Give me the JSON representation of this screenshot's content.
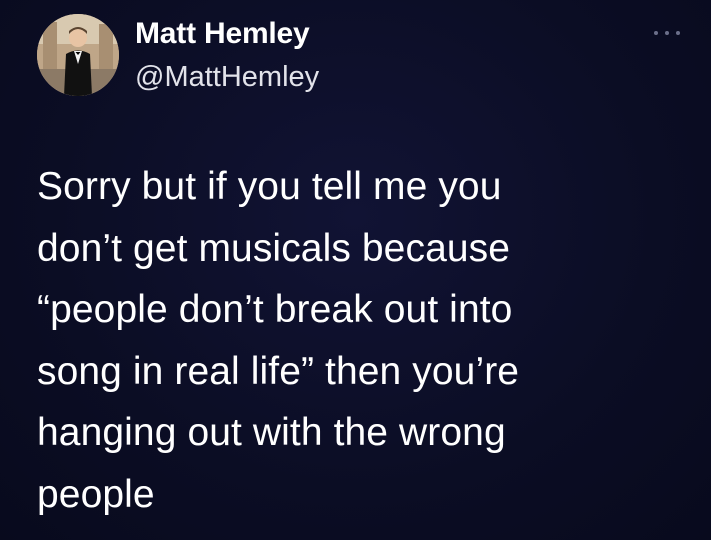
{
  "tweet": {
    "author_name": "Matt Hemley",
    "author_handle": "@MattHemley",
    "avatar_icon": "profile-photo-icon",
    "more_icon": "more-options-icon",
    "text": "Sorry but if you tell me you\ndon’t get musicals because\n“people don’t break out into\nsong in real life” then you’re\nhanging out with the wrong\npeople"
  },
  "colors": {
    "background": "#0b0d24",
    "text": "#ffffff",
    "handle": "#e2e3ea",
    "more_icon": "#6b6f8a"
  }
}
